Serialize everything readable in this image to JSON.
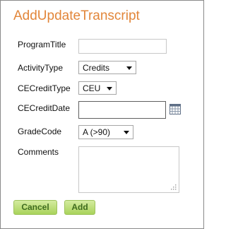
{
  "form": {
    "title": "AddUpdateTranscript",
    "fields": {
      "program_title": {
        "label": "ProgramTitle",
        "value": ""
      },
      "activity_type": {
        "label": "ActivityType",
        "value": "Credits"
      },
      "ce_credit_type": {
        "label": "CECreditType",
        "value": "CEU"
      },
      "ce_credit_date": {
        "label": "CECreditDate",
        "value": ""
      },
      "grade_code": {
        "label": "GradeCode",
        "value": "A (>90)"
      },
      "comments": {
        "label": "Comments",
        "value": ""
      }
    },
    "buttons": {
      "cancel": "Cancel",
      "add": "Add"
    }
  },
  "icons": {
    "calendar": "calendar-icon",
    "resize": "resize-grip-icon"
  },
  "colors": {
    "title": "#e2863a",
    "button_bg": "#bfe07d",
    "button_text": "#3f6b1f"
  }
}
